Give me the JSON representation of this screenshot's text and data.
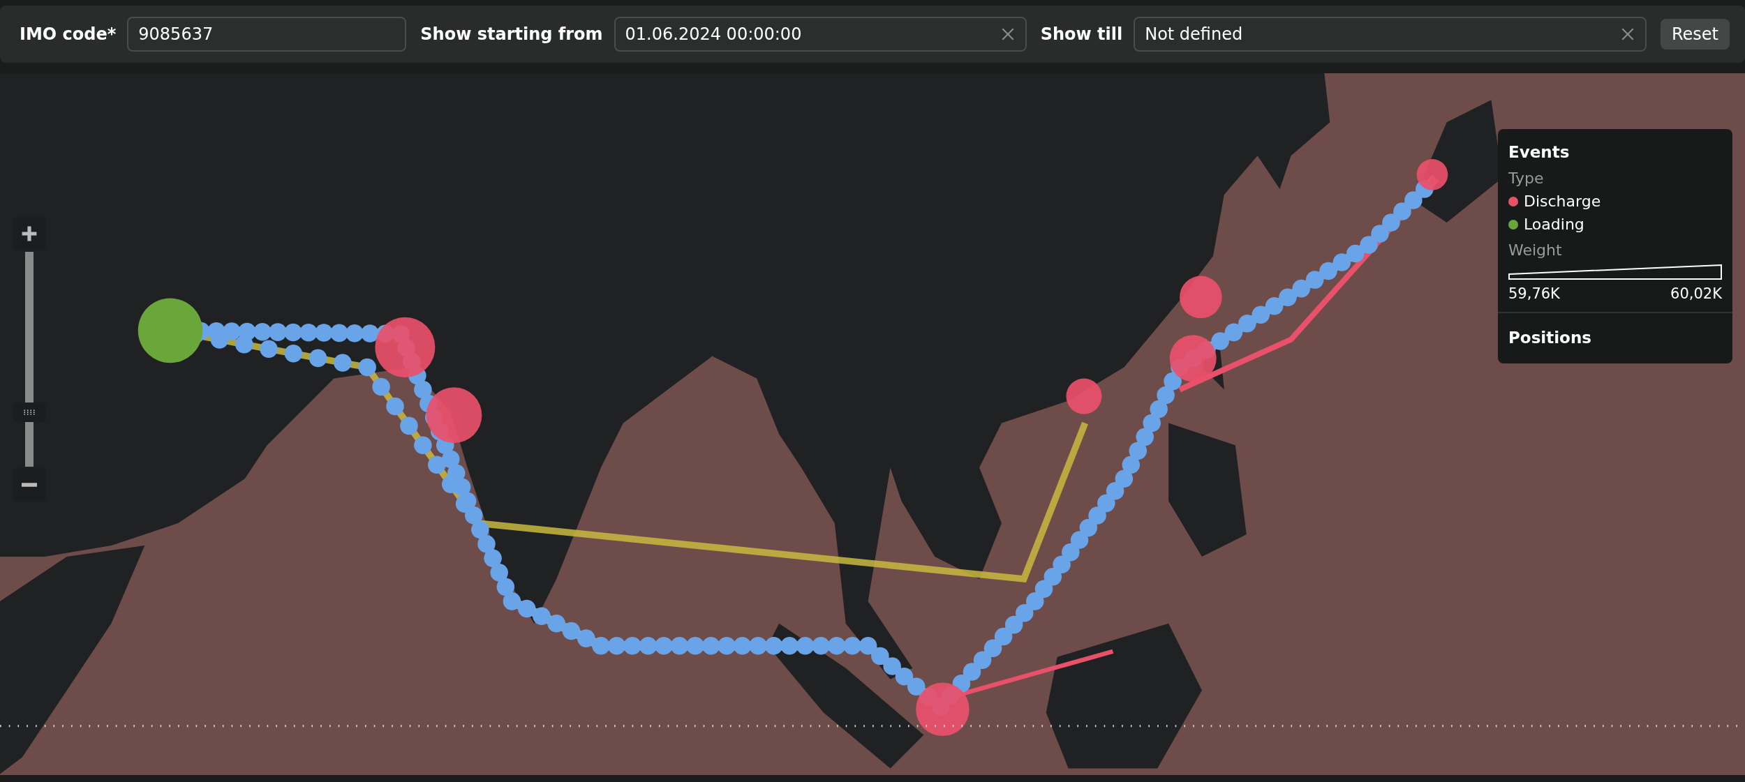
{
  "filters": [
    {
      "label": "IMO code*",
      "value": "9085637",
      "clearable": false
    },
    {
      "label": "Show starting from",
      "value": "01.06.2024 00:00:00",
      "clearable": true
    },
    {
      "label": "Show till",
      "value": "Not defined",
      "clearable": true
    }
  ],
  "reset_button": "Reset",
  "map": {
    "zoom": {
      "level": 0.23
    },
    "legend": {
      "title": "Events",
      "type_heading": "Type",
      "types": [
        {
          "label": "Discharge",
          "color": "#e9506a"
        },
        {
          "label": "Loading",
          "color": "#6aa63a"
        }
      ],
      "weight_heading": "Weight",
      "weight_min": "59,76K",
      "weight_max": "60,02K",
      "positions": "Positions"
    }
  }
}
